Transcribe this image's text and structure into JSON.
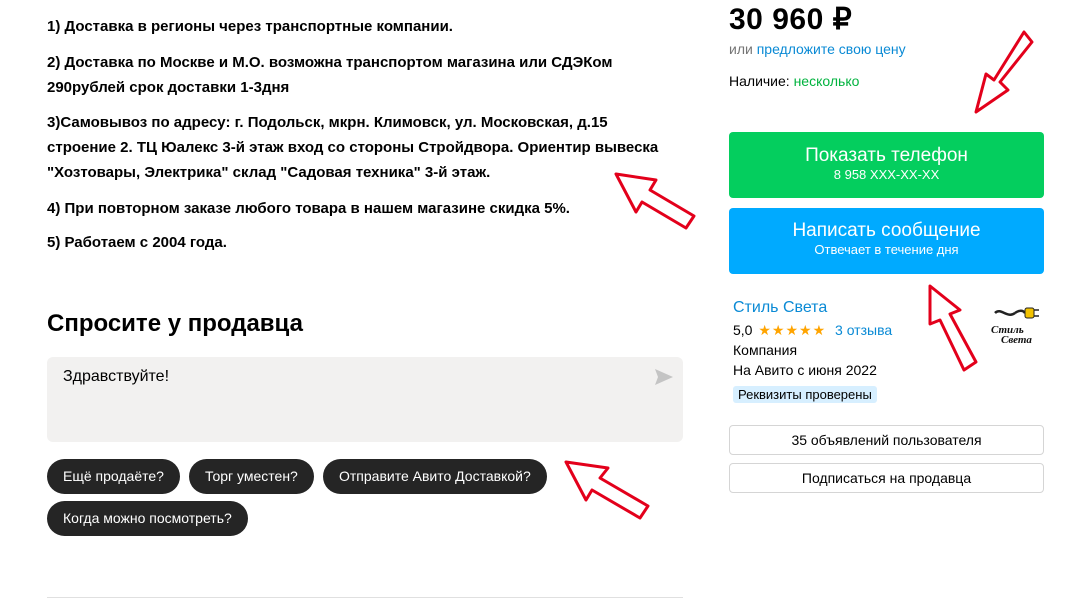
{
  "info_lines": [
    "1) Доставка в регионы через транспортные компании.",
    "2) Доставка по Москве и М.О. возможна транспортом магазина или СДЭКом 290рублей срок доставки 1-3дня",
    "3)Самовывоз по адресу: г. Подольск, мкрн. Климовск, ул. Московская, д.15 строение 2. ТЦ Юалекс 3-й этаж вход со стороны Стройдвора. Ориентир вывеска \"Хозтовары, Электрика\" склад \"Садовая техника\" 3-й этаж.",
    "4) При повторном заказе любого товара в нашем магазине скидка 5%.",
    "5) Работаем с 2004 года."
  ],
  "ask": {
    "title": "Спросите у продавца",
    "message_value": "Здравствуйте!",
    "send_icon": "send-arrow-icon",
    "chips": [
      "Ещё продаёте?",
      "Торг уместен?",
      "Отправите Авито Доставкой?",
      "Когда можно посмотреть?"
    ]
  },
  "sidebar": {
    "price": "30 960 ₽",
    "offer_prefix": "или ",
    "offer_link": "предложите свою цену",
    "availability_label": "Наличие: ",
    "availability_value": "несколько",
    "phone_button": {
      "label": "Показать телефон",
      "sub": "8 958 XXX-XX-XX",
      "color": "#04ce5e"
    },
    "message_button": {
      "label": "Написать сообщение",
      "sub": "Отвечает в течение дня",
      "color": "#00aaff"
    },
    "seller": {
      "name": "Стиль Света",
      "rating": "5,0",
      "stars": 5,
      "reviews": "3 отзыва",
      "type": "Компания",
      "since": "На Авито с июня 2022",
      "verified_badge": "Реквизиты проверены",
      "logo_text": "Стиль Света",
      "logo_icon": "plug-icon"
    },
    "ads_button": "35 объявлений пользователя",
    "subscribe_button": "Подписаться на продавца"
  },
  "colors": {
    "link": "#0a8ad5",
    "green": "#02b33f",
    "annotation_arrow": "#e3001b"
  }
}
